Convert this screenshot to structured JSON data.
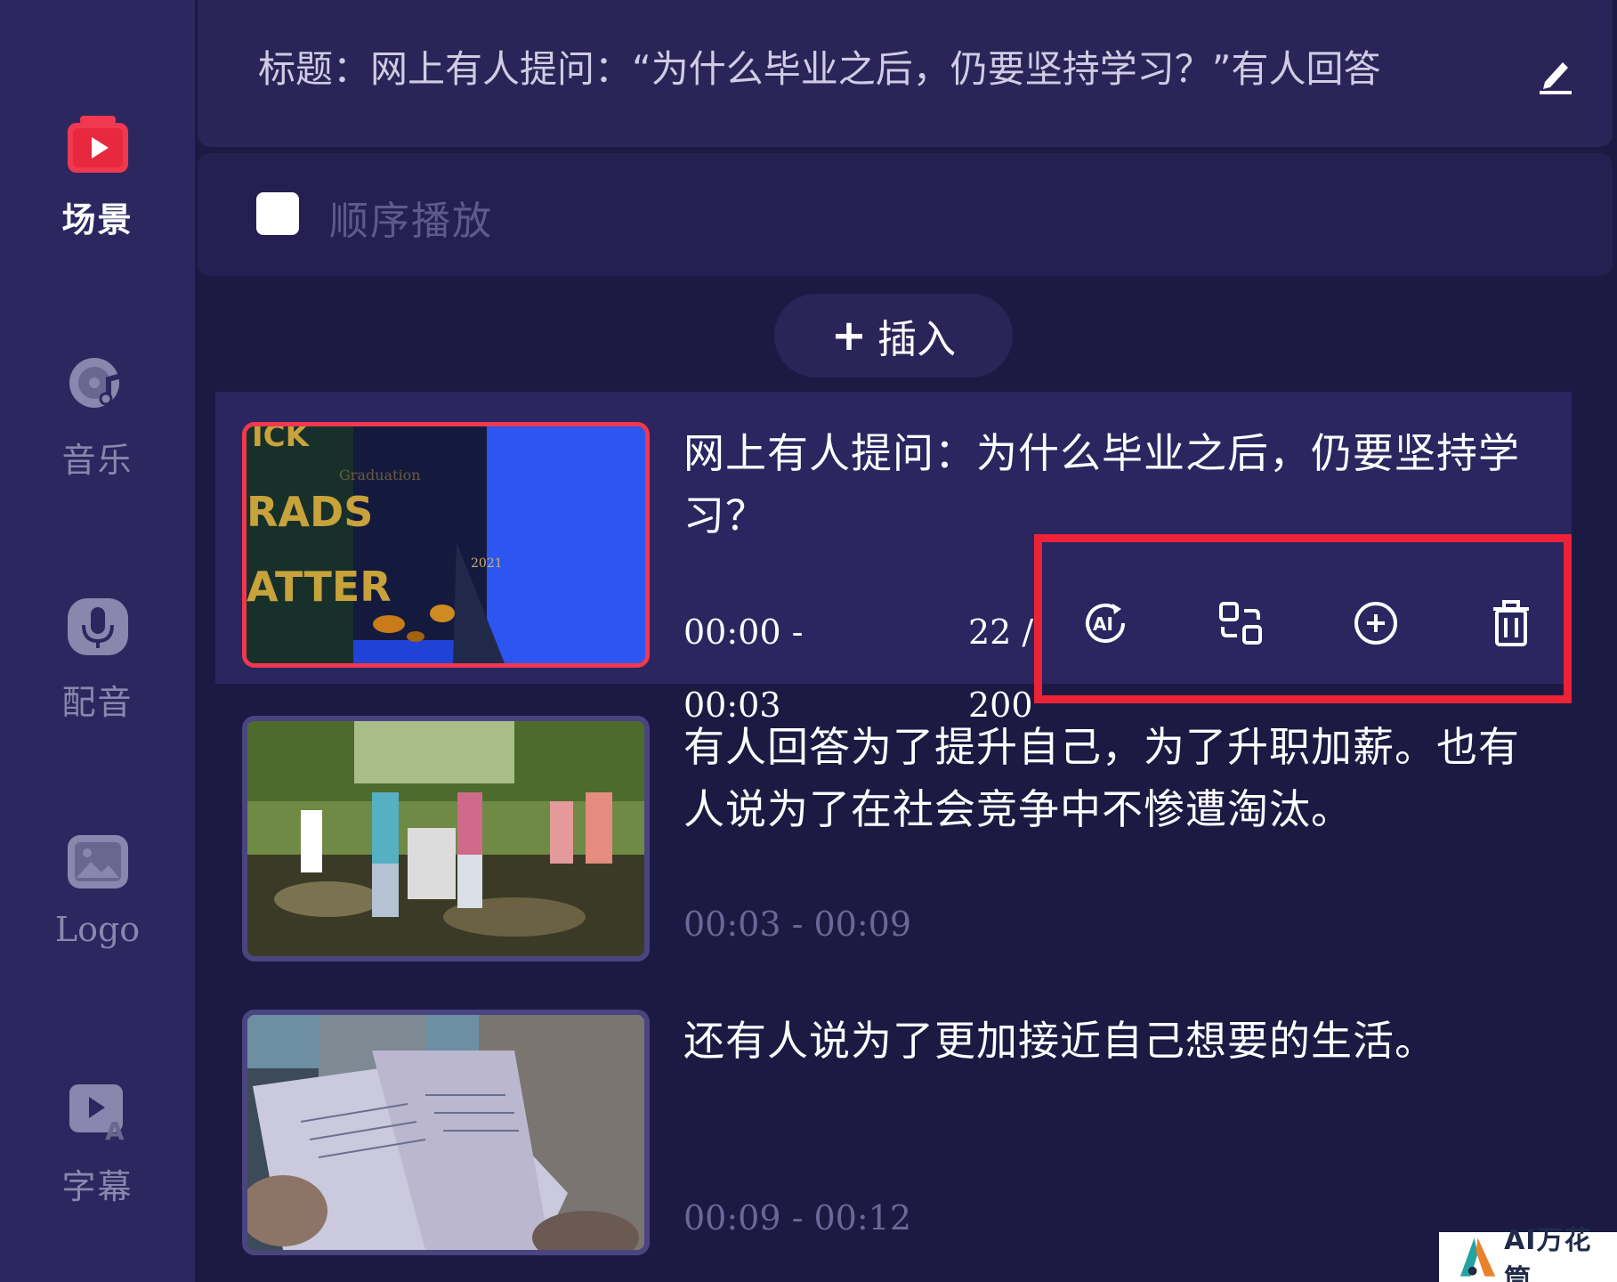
{
  "sidebar": {
    "items": [
      {
        "label": "场景",
        "icon": "scene-icon",
        "active": true
      },
      {
        "label": "音乐",
        "icon": "music-disc-icon",
        "active": false
      },
      {
        "label": "配音",
        "icon": "microphone-icon",
        "active": false
      },
      {
        "label": "Logo",
        "icon": "image-icon",
        "active": false
      },
      {
        "label": "字幕",
        "icon": "subtitle-icon",
        "active": false
      }
    ]
  },
  "header": {
    "title": "标题：网上有人提问：“为什么毕业之后，仍要坚持学习？”有人回答",
    "edit_icon": "pencil-icon"
  },
  "playback": {
    "sequential_label": "顺序播放",
    "sequential_checked": false
  },
  "insert_button": {
    "plus": "+",
    "label": "插入"
  },
  "scenes": [
    {
      "text": "网上有人提问：为什么毕业之后，仍要坚持学习？",
      "time_start": "00:00 -",
      "time_end": "00:03",
      "count_top": "22 /",
      "count_bottom": "200",
      "selected": true
    },
    {
      "text": "有人回答为了提升自己，为了升职加薪。也有人说为了在社会竞争中不惨遭淘汰。",
      "time": "00:03 - 00:09",
      "selected": false
    },
    {
      "text": "还有人说为了更加接近自己想要的生活。",
      "time": "00:09 - 00:12",
      "selected": false
    }
  ],
  "scene_actions": [
    {
      "name": "ai-rewrite",
      "icon": "ai-icon"
    },
    {
      "name": "replace-media",
      "icon": "swap-icon"
    },
    {
      "name": "add-scene",
      "icon": "plus-circle-icon"
    },
    {
      "name": "delete-scene",
      "icon": "trash-icon"
    }
  ],
  "thumbnail_text": {
    "scene1_lines": [
      "ICK",
      "RADS",
      "ATTER"
    ],
    "scene1_year": "2021",
    "scene1_script": "Graduation"
  },
  "watermark": {
    "text": "AI万花筒"
  },
  "colors": {
    "background": "#1c1a43",
    "sidebar": "#2d2760",
    "accent_red": "#ee2236",
    "selected_border": "#f0384f"
  }
}
